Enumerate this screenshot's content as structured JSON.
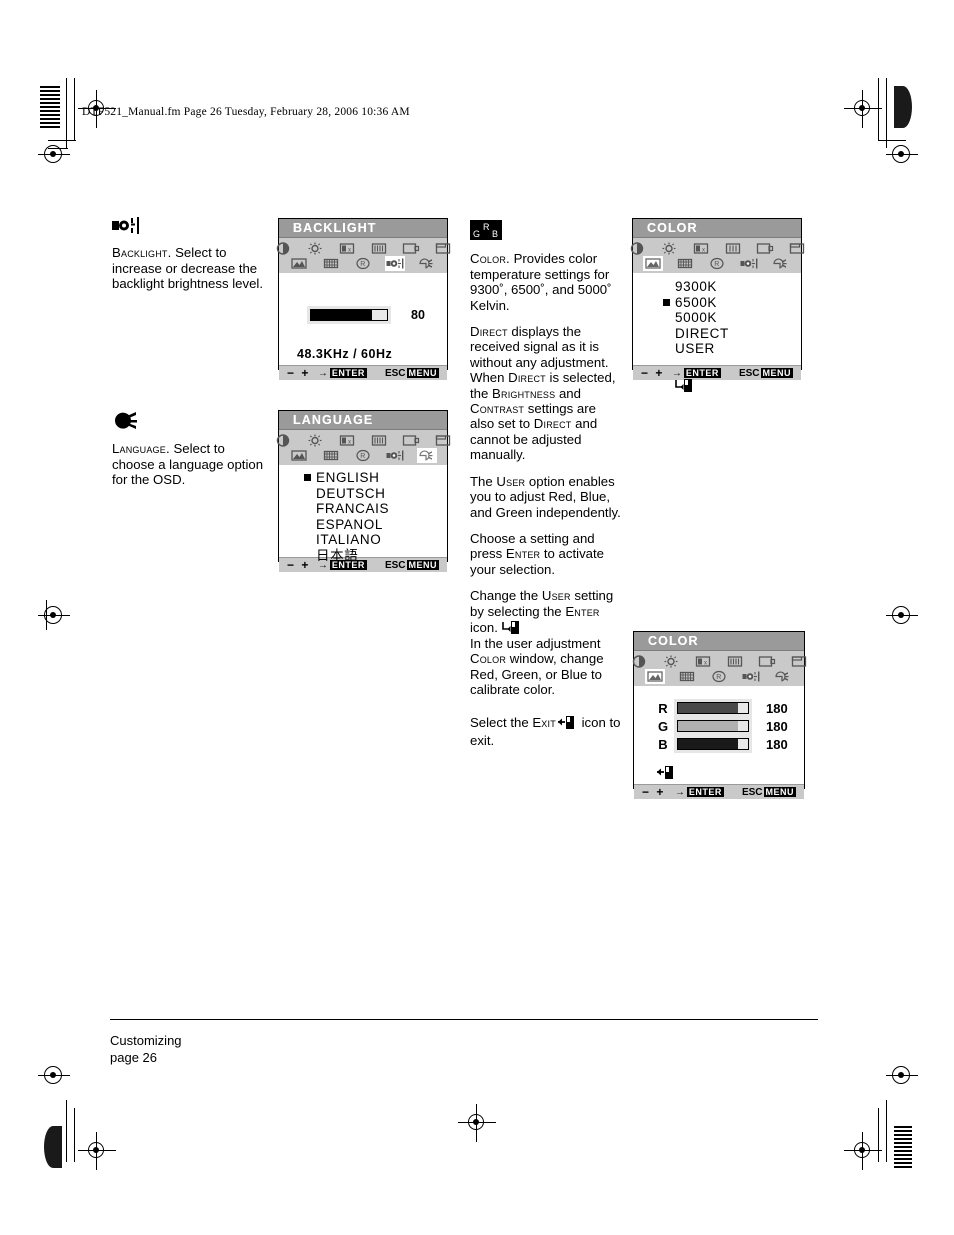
{
  "page": {
    "file_header": "DTF521_Manual.fm  Page 26  Tuesday, February 28, 2006  10:36 AM",
    "footer_section": "Customizing",
    "footer_page": "page  26"
  },
  "left_column": {
    "backlight": {
      "icon": "backlight-icon",
      "term": "Backlight.",
      "text": "  Select to increase or decrease the backlight brightness level."
    },
    "language": {
      "icon": "language-icon",
      "term": "Language.",
      "text": "  Select to choose a language option for the OSD."
    }
  },
  "middle_column": {
    "color_icon_letters": {
      "g": "G",
      "r": "R",
      "b": "B"
    },
    "paragraphs": [
      {
        "term": "Color.",
        "text": "  Provides color temperature settings for 9300˚, 6500˚, and 5000˚ Kelvin."
      },
      {
        "term": "Direct",
        "text": " displays the received signal as it is without any adjustment. When ",
        "term2": "Direct",
        "text2": " is selected, the ",
        "term3": "Brightness",
        "text3": " and ",
        "term4": "Contrast",
        "text4": " settings are also set to ",
        "term5": "Direct",
        "text5": " and cannot be adjusted manually."
      },
      {
        "pre": "The ",
        "term": "User",
        "text": " option enables you to adjust Red, Blue, and Green independently."
      },
      {
        "pre": "Choose a setting and press ",
        "term": "Enter",
        "text": " to activate your selection."
      },
      {
        "pre": "Change the ",
        "term": "User",
        "text": " setting by selecting the ",
        "term2": "Enter",
        "text2": " icon. "
      },
      {
        "pre": "In the user adjustment ",
        "term": "Color",
        "text": " window, change Red, Green, or Blue to calibrate color."
      },
      {
        "pre": "Select the ",
        "term": "Exit",
        "text": " icon to exit."
      }
    ]
  },
  "osd_icons": {
    "row1": [
      "contrast-icon",
      "brightness-icon",
      "h-position-icon",
      "v-size-icon",
      "h-size-icon",
      "osd-position-icon"
    ],
    "row2": [
      "color-icon",
      "moire-icon",
      "recall-icon",
      "backlight-icon",
      "language-icon"
    ]
  },
  "osd_footer": {
    "minus_plus": "− +",
    "enter_arrow": "→",
    "enter_label": "ENTER",
    "esc_label": "ESC",
    "menu_label": "MENU"
  },
  "panels": {
    "backlight": {
      "title": "BACKLIGHT",
      "selected_icon": "backlight-icon",
      "slider_value": "80",
      "slider_percent": 80,
      "slider_fill_color": "#000000",
      "frequency": "48.3KHz   /    60Hz"
    },
    "language": {
      "title": "LANGUAGE",
      "selected_icon": "language-icon",
      "options": [
        {
          "label": "ENGLISH",
          "selected": true
        },
        {
          "label": "DEUTSCH",
          "selected": false
        },
        {
          "label": "FRANCAIS",
          "selected": false
        },
        {
          "label": "ESPANOL",
          "selected": false
        },
        {
          "label": "ITALIANO",
          "selected": false
        },
        {
          "label": "日本語",
          "selected": false
        }
      ]
    },
    "color_temp": {
      "title": "COLOR",
      "selected_icon": "color-icon",
      "options": [
        {
          "label": "9300K",
          "selected": false
        },
        {
          "label": "6500K",
          "selected": true
        },
        {
          "label": "5000K",
          "selected": false
        },
        {
          "label": "DIRECT",
          "selected": false
        },
        {
          "label": "USER",
          "selected": false
        }
      ],
      "enter_icon": "enter-icon"
    },
    "color_user": {
      "title": "COLOR",
      "selected_icon": "color-icon",
      "channels": [
        {
          "label": "R",
          "value": "180",
          "percent": 85,
          "color": "#4a4a4a"
        },
        {
          "label": "G",
          "value": "180",
          "percent": 85,
          "color": "#b0b0b0"
        },
        {
          "label": "B",
          "value": "180",
          "percent": 85,
          "color": "#1a1a1a"
        }
      ],
      "exit_icon": "exit-icon"
    }
  }
}
